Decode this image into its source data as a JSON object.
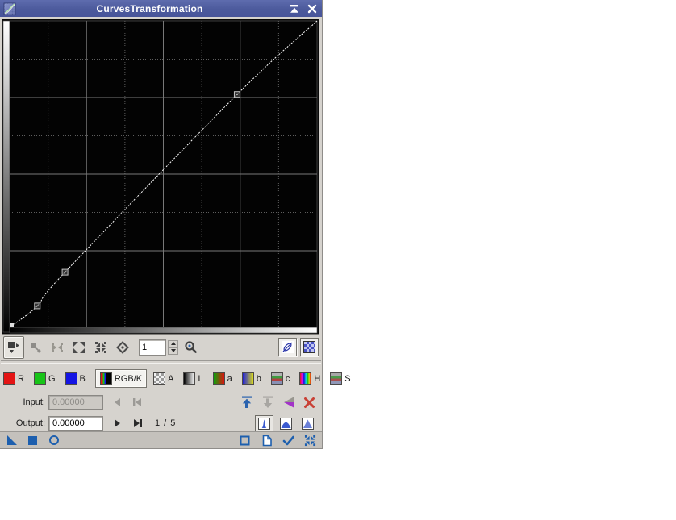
{
  "window": {
    "title": "CurvesTransformation"
  },
  "curve": {
    "type": "line",
    "points": [
      [
        0,
        0
      ],
      [
        0.09,
        0.07
      ],
      [
        0.18,
        0.18
      ],
      [
        0.74,
        0.76
      ],
      [
        1,
        1
      ]
    ],
    "selected_point": 1,
    "total_points": 5,
    "grid_divisions": 8,
    "interpolation": "akima",
    "plot_bg": "#000000",
    "line_color": "#ffffff",
    "solid_grid_color": "#787878",
    "dotted_grid_color": "#5e5e5e"
  },
  "toolbar": {
    "zoom_value": "1"
  },
  "channels": {
    "items": [
      {
        "id": "R",
        "label": "R",
        "selected": false
      },
      {
        "id": "G",
        "label": "G",
        "selected": false
      },
      {
        "id": "B",
        "label": "B",
        "selected": false
      },
      {
        "id": "RGBK",
        "label": "RGB/K",
        "selected": true
      },
      {
        "id": "A",
        "label": "A",
        "selected": false
      },
      {
        "id": "L",
        "label": "L",
        "selected": false
      },
      {
        "id": "a",
        "label": "a",
        "selected": false
      },
      {
        "id": "b",
        "label": "b",
        "selected": false
      },
      {
        "id": "c",
        "label": "c",
        "selected": false
      },
      {
        "id": "H",
        "label": "H",
        "selected": false
      },
      {
        "id": "S",
        "label": "S",
        "selected": false
      }
    ]
  },
  "io": {
    "input_label": "Input:",
    "input_value": "0.00000",
    "input_enabled": false,
    "output_label": "Output:",
    "output_value": "0.00000",
    "point_indicator": "1 / 5"
  },
  "colors": {
    "titlebar_blue": "#4d5b9e",
    "dialog_bg": "#d6d3ce",
    "icon_blue": "#1d5fae",
    "store_blue": "#2b63ae",
    "delete_red": "#c94136",
    "invert_purple": "#a232c8",
    "disabled_gray": "#9c9a96"
  }
}
